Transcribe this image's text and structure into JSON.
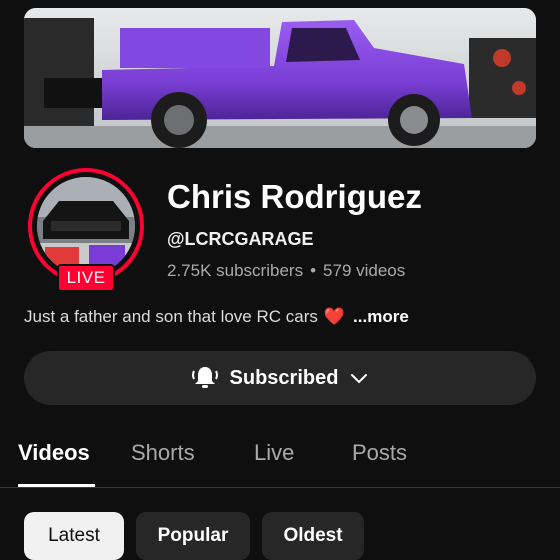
{
  "channel": {
    "name": "Chris Rodriguez",
    "handle": "@LCRCGARAGE",
    "subscribers": "2.75K subscribers",
    "separator": "•",
    "videos": "579 videos",
    "description": "Just a father and son that love RC cars",
    "description_emoji": "❤️",
    "more_label": "...more",
    "live_badge": "LIVE"
  },
  "subscribe": {
    "label": "Subscribed",
    "icon": "bell-ringing-icon",
    "chevron": "chevron-down-icon"
  },
  "tabs": [
    {
      "label": "Videos",
      "active": true
    },
    {
      "label": "Shorts",
      "active": false
    },
    {
      "label": "Live",
      "active": false
    },
    {
      "label": "Posts",
      "active": false
    }
  ],
  "filters": [
    {
      "label": "Latest",
      "active": true
    },
    {
      "label": "Popular",
      "active": false
    },
    {
      "label": "Oldest",
      "active": false
    }
  ],
  "colors": {
    "background": "#0f0f0f",
    "live_red": "#ff0033",
    "button_bg": "#272727",
    "banner_truck": "#7b3fd6"
  }
}
